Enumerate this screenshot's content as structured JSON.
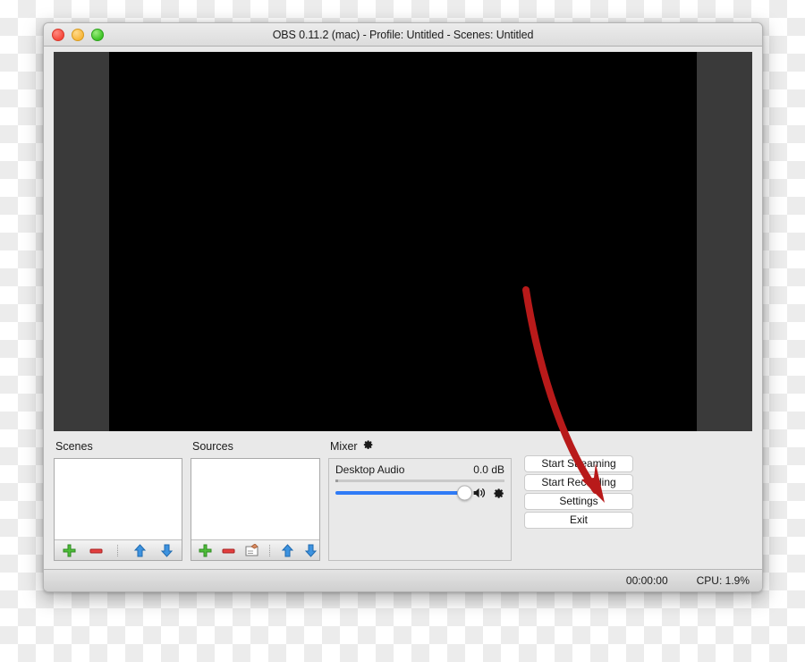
{
  "window": {
    "title": "OBS 0.11.2 (mac) - Profile: Untitled - Scenes: Untitled",
    "traffic_lights": {
      "close": "close-button",
      "minimize": "minimize-button",
      "zoom": "zoom-button"
    }
  },
  "preview": {
    "canvas_color": "#000000",
    "letterbox_color": "#3a3a3a"
  },
  "scenes": {
    "title": "Scenes",
    "items": [],
    "toolbar": [
      {
        "icon": "add-icon",
        "label": "+"
      },
      {
        "icon": "remove-icon",
        "label": "–"
      },
      {
        "icon": "move-up-icon",
        "label": "↑"
      },
      {
        "icon": "move-down-icon",
        "label": "↓"
      }
    ]
  },
  "sources": {
    "title": "Sources",
    "items": [],
    "toolbar": [
      {
        "icon": "add-icon",
        "label": "+"
      },
      {
        "icon": "remove-icon",
        "label": "–"
      },
      {
        "icon": "properties-icon",
        "label": "⚙"
      },
      {
        "icon": "move-up-icon",
        "label": "↑"
      },
      {
        "icon": "move-down-icon",
        "label": "↓"
      }
    ]
  },
  "mixer": {
    "title": "Mixer",
    "gear_icon": "gear-icon",
    "channels": [
      {
        "name": "Desktop Audio",
        "level": "0.0 dB",
        "volume_percent": 100,
        "speaker_icon": "speaker-icon",
        "settings_icon": "gear-icon"
      }
    ]
  },
  "controls": {
    "buttons": [
      {
        "label": "Start Streaming",
        "name": "start-streaming-button"
      },
      {
        "label": "Start Recording",
        "name": "start-recording-button"
      },
      {
        "label": "Settings",
        "name": "settings-button"
      },
      {
        "label": "Exit",
        "name": "exit-button"
      }
    ]
  },
  "statusbar": {
    "timer": "00:00:00",
    "cpu": "CPU: 1.9%"
  },
  "annotation": {
    "arrow_color": "#b81a1a",
    "points_to": "Settings"
  },
  "colors": {
    "accent_slider": "#2f7bf6",
    "window_chrome": "#e9e9e9",
    "arrow_red": "#b81a1a"
  }
}
